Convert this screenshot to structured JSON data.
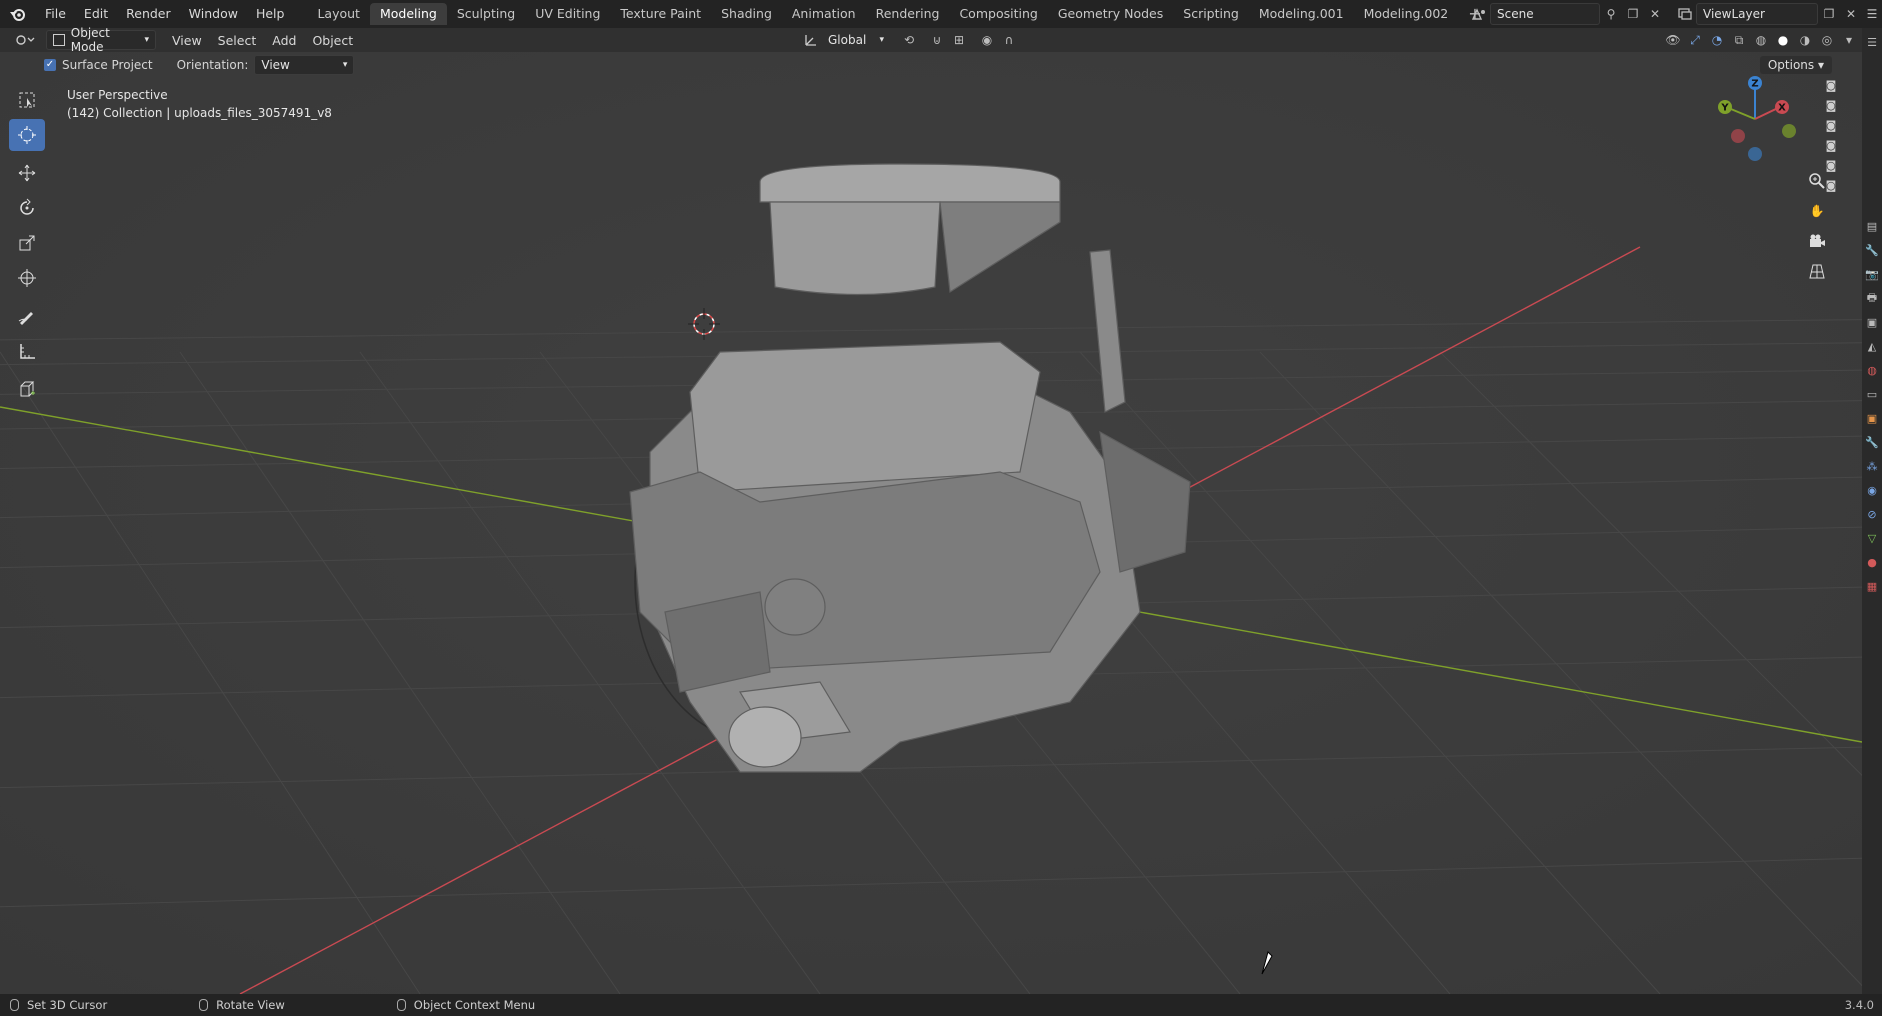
{
  "menubar": {
    "items": [
      "File",
      "Edit",
      "Render",
      "Window",
      "Help"
    ]
  },
  "workspace_tabs": [
    "Layout",
    "Modeling",
    "Sculpting",
    "UV Editing",
    "Texture Paint",
    "Shading",
    "Animation",
    "Rendering",
    "Compositing",
    "Geometry Nodes",
    "Scripting",
    "Modeling.001",
    "Modeling.002"
  ],
  "active_tab": "Modeling",
  "scene": {
    "name": "Scene",
    "view_layer": "ViewLayer"
  },
  "header": {
    "mode": "Object Mode",
    "menus": [
      "View",
      "Select",
      "Add",
      "Object"
    ],
    "transform_orientation": "Global"
  },
  "tool_options": {
    "surface_project_label": "Surface Project",
    "surface_project_checked": true,
    "orientation_label": "Orientation:",
    "orientation_value": "View",
    "options_label": "Options"
  },
  "viewport": {
    "perspective": "User Perspective",
    "collection_info": "(142) Collection | uploads_files_3057491_v8",
    "gizmo_axes": [
      "X",
      "Y",
      "Z"
    ],
    "colors": {
      "x_axis": "#c94a52",
      "y_axis": "#7fa12a",
      "z_axis": "#3b83d1",
      "grid": "#464646",
      "background": "#3d3d3d",
      "active_tool": "#4772b3"
    }
  },
  "toolbar_icons": [
    "select-box-icon",
    "cursor-icon",
    "move-icon",
    "rotate-icon",
    "scale-icon",
    "transform-icon",
    "annotate-icon",
    "measure-icon",
    "add-cube-icon"
  ],
  "statusbar": {
    "left_click": "Set 3D Cursor",
    "middle_click": "Rotate View",
    "right_click": "Object Context Menu",
    "version": "3.4.0"
  }
}
